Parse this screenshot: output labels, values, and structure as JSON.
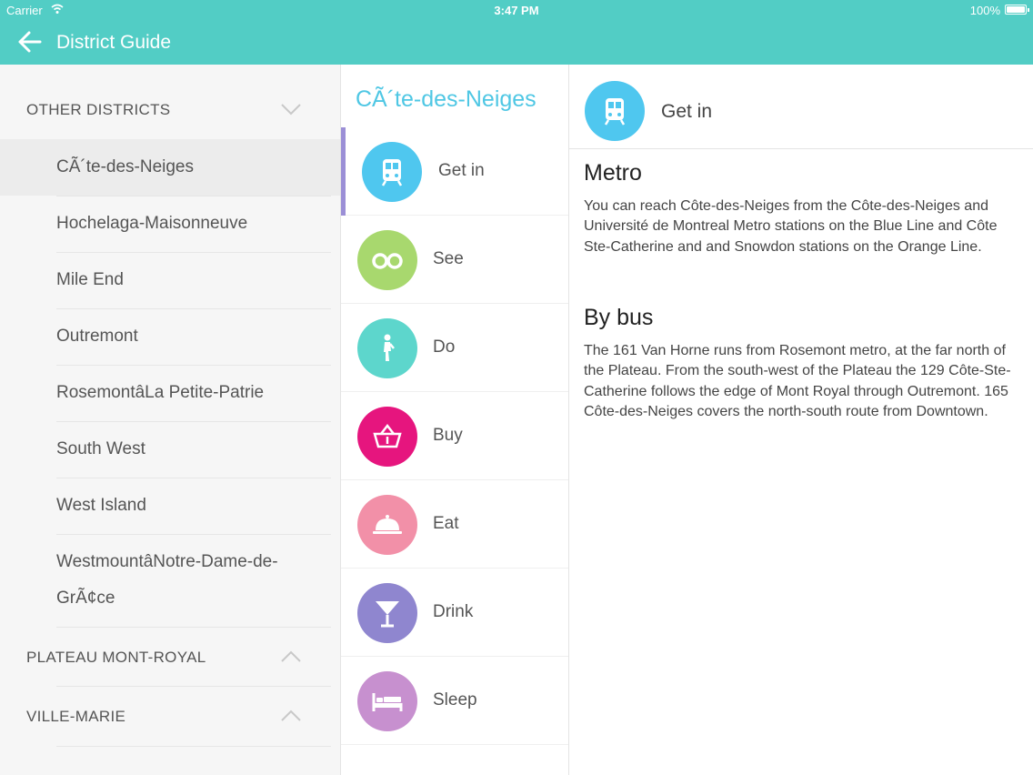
{
  "status_bar": {
    "carrier": "Carrier",
    "time": "3:47 PM",
    "battery": "100%"
  },
  "navbar": {
    "title": "District Guide",
    "back_icon": "arrow-left-icon"
  },
  "sidebar": {
    "groups": [
      {
        "label": "OTHER DISTRICTS",
        "expanded": true
      },
      {
        "label": "PLATEAU MONT-ROYAL",
        "expanded": false
      },
      {
        "label": "VILLE-MARIE",
        "expanded": false
      }
    ],
    "items": [
      {
        "label": "CÃ´te-des-Neiges",
        "selected": true
      },
      {
        "label": "Hochelaga-Maisonneuve"
      },
      {
        "label": "Mile End"
      },
      {
        "label": "Outremont"
      },
      {
        "label": "RosemontâLa Petite-Patrie"
      },
      {
        "label": "South West"
      },
      {
        "label": "West Island"
      },
      {
        "label": "WestmountâNotre-Dame-de-GrÃ¢ce"
      }
    ]
  },
  "middle": {
    "district_title": "CÃ´te-des-Neiges",
    "categories": [
      {
        "label": "Get in",
        "icon": "train-icon",
        "color": "#4fc7ef"
      },
      {
        "label": "See",
        "icon": "binoculars-icon",
        "color": "#a8d86e"
      },
      {
        "label": "Do",
        "icon": "hiker-icon",
        "color": "#5dd6cc"
      },
      {
        "label": "Buy",
        "icon": "basket-icon",
        "color": "#e6157e"
      },
      {
        "label": "Eat",
        "icon": "cloche-icon",
        "color": "#f290a8"
      },
      {
        "label": "Drink",
        "icon": "cocktail-icon",
        "color": "#8f86cf"
      },
      {
        "label": "Sleep",
        "icon": "bed-icon",
        "color": "#c790cf"
      }
    ]
  },
  "detail": {
    "header_label": "Get in",
    "header_icon": "train-icon",
    "sections": [
      {
        "heading": "Metro",
        "body": "You can reach Côte-des-Neiges from the Côte-des-Neiges and Université de Montreal Metro stations on the Blue Line and Côte Ste-Catherine and and Snowdon stations on the Orange Line."
      },
      {
        "heading": "By bus",
        "body": "The 161 Van Horne runs from Rosemont metro, at the far north of the Plateau. From the south-west of the Plateau the 129 Côte-Ste-Catherine follows the edge of Mont Royal through Outremont. 165 Côte-des-Neiges covers the north-south route from Downtown."
      }
    ]
  },
  "colors": {
    "accent": "#52cdc5",
    "title_blue": "#4fc7e4",
    "active_bar": "#9b8fd6"
  }
}
